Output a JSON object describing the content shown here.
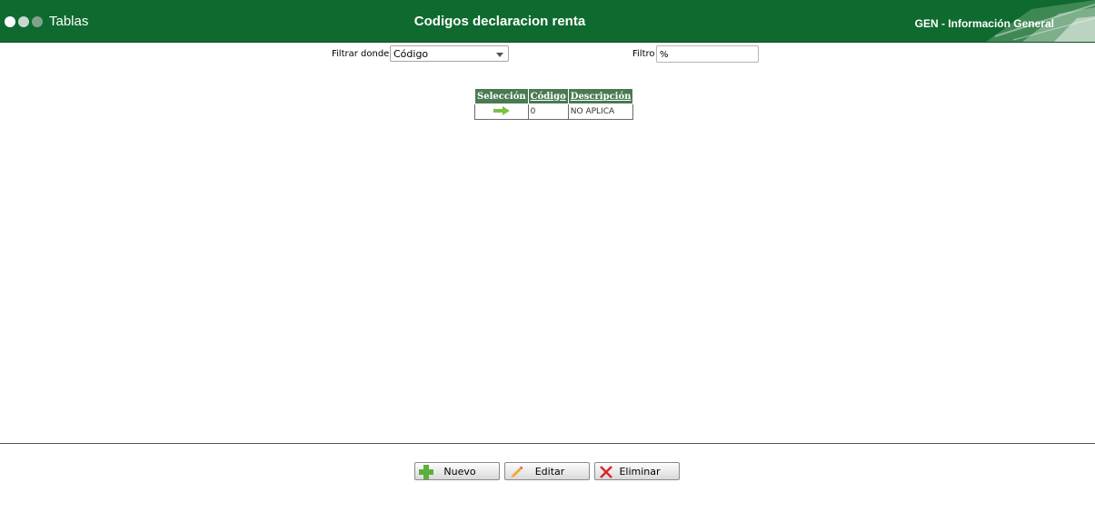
{
  "header": {
    "app_title": "Tablas",
    "page_title": "Codigos declaracion renta",
    "module_title": "GEN - Información General"
  },
  "filter": {
    "where_label": "Filtrar donde",
    "where_value": "Código",
    "filter_label": "Filtro",
    "filter_value": "%"
  },
  "table": {
    "columns": [
      "Selección",
      "Código",
      "Descripción"
    ],
    "rows": [
      {
        "code": "0",
        "description": "NO APLICA"
      }
    ]
  },
  "buttons": {
    "new_label": "Nuevo",
    "edit_label": "Editar",
    "delete_label": "Eliminar"
  },
  "colors": {
    "header_bg": "#0f6a2f",
    "table_header_bg": "#4a7a52",
    "select_arrow": "#7cc242"
  }
}
